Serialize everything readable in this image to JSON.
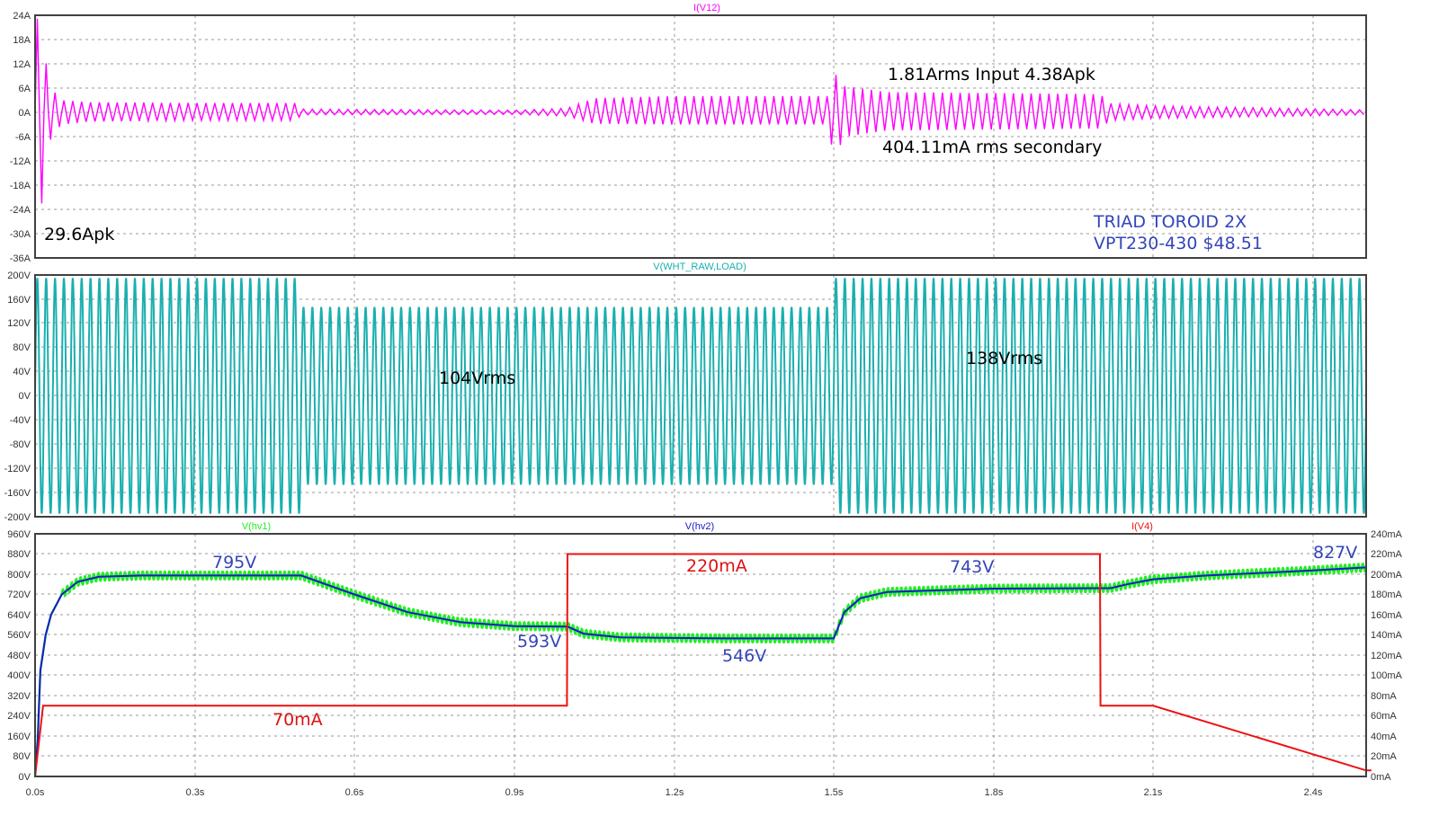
{
  "colors": {
    "v12": "#ff00ff",
    "wht": "#1aafaf",
    "hv1": "#22ee22",
    "hv2": "#1a1acc",
    "i4": "#ee1111",
    "annotation_dark": "#000000",
    "annotation_blue": "#3344bb",
    "annotation_red": "#dd1111"
  },
  "chart_data": [
    {
      "type": "line",
      "panel": "top",
      "trace_label": "I(V12)",
      "series": [
        {
          "name": "I(V12)",
          "color": "#ff00ff"
        }
      ],
      "x_ticks": [],
      "y_ticks": [
        "24A",
        "18A",
        "12A",
        "6A",
        "0A",
        "-6A",
        "-12A",
        "-18A",
        "-24A",
        "-30A",
        "-36A"
      ],
      "ylim": [
        -36,
        24
      ],
      "xlim": [
        0,
        2.5
      ],
      "grid": true,
      "envelope_points": [
        [
          0.0,
          24.0,
          -30.0
        ],
        [
          0.005,
          23.0,
          -30.0
        ],
        [
          0.015,
          16.0,
          -20.0
        ],
        [
          0.03,
          6.0,
          -6.0
        ],
        [
          0.05,
          3.0,
          -3.0
        ],
        [
          0.1,
          2.5,
          -2.3
        ],
        [
          0.3,
          2.3,
          -2.0
        ],
        [
          0.49,
          2.3,
          -2.0
        ],
        [
          0.5,
          0.8,
          -0.6
        ],
        [
          0.9,
          0.5,
          -0.5
        ],
        [
          1.0,
          1.0,
          -0.9
        ],
        [
          1.05,
          3.5,
          -2.8
        ],
        [
          1.2,
          4.0,
          -3.0
        ],
        [
          1.49,
          4.0,
          -3.0
        ],
        [
          1.5,
          10.0,
          -11.5
        ],
        [
          1.52,
          6.5,
          -6.0
        ],
        [
          1.6,
          5.0,
          -4.5
        ],
        [
          2.0,
          4.5,
          -4.0
        ],
        [
          2.02,
          2.2,
          -2.0
        ],
        [
          2.1,
          1.6,
          -1.5
        ],
        [
          2.5,
          0.6,
          -0.6
        ]
      ],
      "annotations": [
        {
          "text": "1.81Arms Input 4.38Apk",
          "color": "#000000"
        },
        {
          "text": "404.11mA rms secondary",
          "color": "#000000"
        },
        {
          "text": "29.6Apk",
          "color": "#000000"
        },
        {
          "text": "TRIAD TOROID 2X",
          "color": "#3344bb"
        },
        {
          "text": "VPT230-430 $48.51",
          "color": "#3344bb"
        }
      ]
    },
    {
      "type": "line",
      "panel": "middle",
      "trace_label": "V(WHT_RAW,LOAD)",
      "series": [
        {
          "name": "V(WHT_RAW,LOAD)",
          "color": "#1aafaf"
        }
      ],
      "y_ticks": [
        "200V",
        "160V",
        "120V",
        "80V",
        "40V",
        "0V",
        "-40V",
        "-80V",
        "-120V",
        "-160V",
        "-200V"
      ],
      "ylim": [
        -200,
        200
      ],
      "xlim": [
        0,
        2.5
      ],
      "grid": true,
      "amplitude_segments": [
        {
          "x_start": 0.0,
          "x_end": 0.5,
          "peak": 195
        },
        {
          "x_start": 0.5,
          "x_end": 1.5,
          "peak": 147
        },
        {
          "x_start": 1.5,
          "x_end": 2.5,
          "peak": 195
        }
      ],
      "annotations": [
        {
          "text": "104Vrms",
          "color": "#000000"
        },
        {
          "text": "138Vrms",
          "color": "#000000"
        }
      ]
    },
    {
      "type": "line",
      "panel": "bottom",
      "trace_labels": [
        "V(hv1)",
        "V(hv2)",
        "I(V4)"
      ],
      "x_ticks": [
        "0.0s",
        "0.3s",
        "0.6s",
        "0.9s",
        "1.2s",
        "1.5s",
        "1.8s",
        "2.1s",
        "2.4s"
      ],
      "xlim": [
        0,
        2.5
      ],
      "y_ticks_left": [
        "960V",
        "880V",
        "800V",
        "720V",
        "640V",
        "560V",
        "480V",
        "400V",
        "320V",
        "240V",
        "160V",
        "80V",
        "0V"
      ],
      "ylim_left": [
        0,
        960
      ],
      "y_ticks_right": [
        "240mA",
        "220mA",
        "200mA",
        "180mA",
        "160mA",
        "140mA",
        "120mA",
        "100mA",
        "80mA",
        "60mA",
        "40mA",
        "20mA",
        "0mA"
      ],
      "ylim_right": [
        0,
        240
      ],
      "grid": true,
      "series": [
        {
          "name": "V(hv1)",
          "color": "#22ee22",
          "axis": "left",
          "ripple": 16,
          "x": [
            0,
            0.005,
            0.01,
            0.02,
            0.03,
            0.05,
            0.08,
            0.12,
            0.2,
            0.3,
            0.5,
            0.6,
            0.7,
            0.8,
            0.9,
            1.0,
            1.03,
            1.1,
            1.3,
            1.5,
            1.52,
            1.55,
            1.6,
            1.8,
            2.0,
            2.02,
            2.05,
            2.1,
            2.2,
            2.3,
            2.4,
            2.5
          ],
          "y": [
            0,
            150,
            420,
            560,
            640,
            720,
            770,
            790,
            795,
            795,
            795,
            720,
            650,
            610,
            595,
            593,
            565,
            550,
            546,
            546,
            650,
            705,
            730,
            743,
            745,
            745,
            760,
            780,
            795,
            805,
            815,
            827
          ]
        },
        {
          "name": "V(hv2)",
          "color": "#1a1acc",
          "axis": "left",
          "ripple": 0,
          "x": [
            0,
            0.005,
            0.01,
            0.02,
            0.03,
            0.05,
            0.08,
            0.12,
            0.2,
            0.3,
            0.5,
            0.6,
            0.7,
            0.8,
            0.9,
            1.0,
            1.03,
            1.1,
            1.3,
            1.5,
            1.52,
            1.55,
            1.6,
            1.8,
            2.0,
            2.02,
            2.05,
            2.1,
            2.2,
            2.3,
            2.4,
            2.5
          ],
          "y": [
            0,
            150,
            420,
            560,
            640,
            720,
            770,
            790,
            795,
            795,
            795,
            720,
            650,
            610,
            595,
            593,
            565,
            550,
            546,
            546,
            650,
            705,
            730,
            743,
            745,
            745,
            760,
            780,
            795,
            805,
            815,
            827
          ]
        },
        {
          "name": "I(V4)",
          "color": "#ee1111",
          "axis": "right",
          "ripple": 0,
          "x": [
            0,
            0.015,
            0.5,
            0.999,
            1.0,
            1.5,
            2.0,
            2.001,
            2.1,
            2.5,
            2.51
          ],
          "y": [
            0,
            70,
            70,
            70,
            220,
            220,
            220,
            70,
            70,
            6,
            6
          ]
        }
      ],
      "annotations": [
        {
          "text": "795V",
          "color": "#3344bb"
        },
        {
          "text": "593V",
          "color": "#3344bb"
        },
        {
          "text": "546V",
          "color": "#3344bb"
        },
        {
          "text": "743V",
          "color": "#3344bb"
        },
        {
          "text": "827V",
          "color": "#3344bb"
        },
        {
          "text": "220mA",
          "color": "#dd1111"
        },
        {
          "text": "70mA",
          "color": "#dd1111"
        }
      ]
    }
  ]
}
